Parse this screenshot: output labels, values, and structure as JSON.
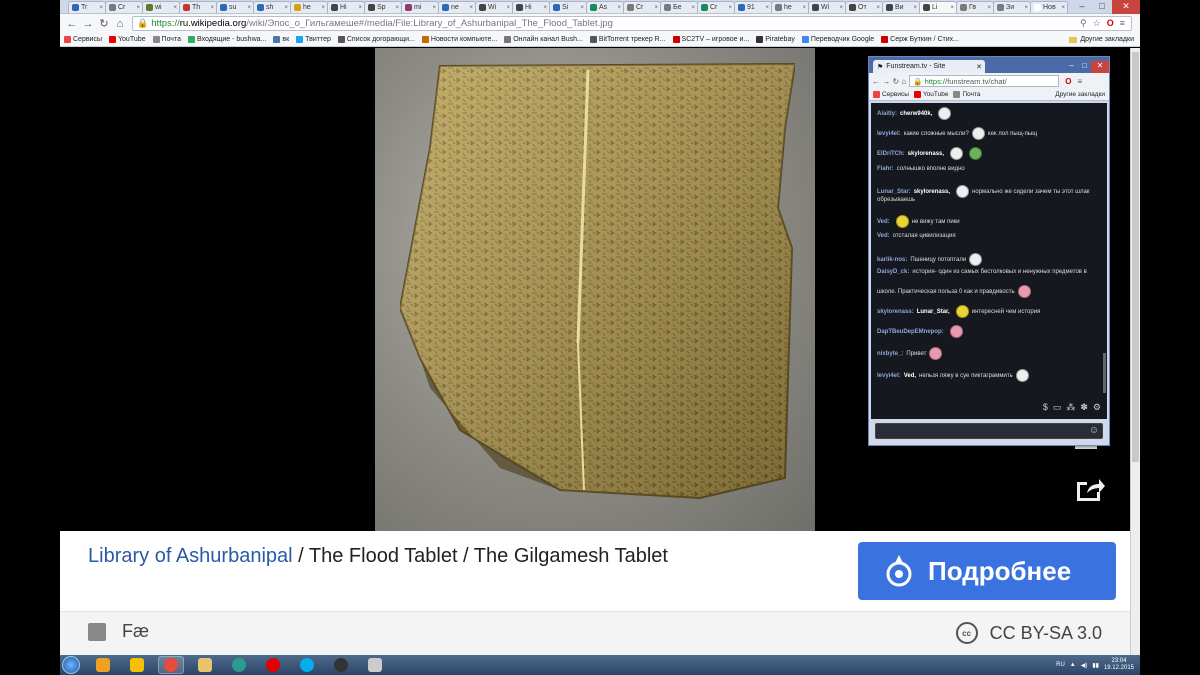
{
  "browser": {
    "tabs": [
      {
        "label": "Tr",
        "color": "#2a6ab6"
      },
      {
        "label": "Cr",
        "color": "#7a7a7a"
      },
      {
        "label": "wi",
        "color": "#5b7a2a"
      },
      {
        "label": "Th",
        "color": "#c0392b"
      },
      {
        "label": "su",
        "color": "#2a6ab6"
      },
      {
        "label": "sh",
        "color": "#2a6ab6"
      },
      {
        "label": "he",
        "color": "#d4a017"
      },
      {
        "label": "Hi",
        "color": "#444444"
      },
      {
        "label": "Sp",
        "color": "#444444"
      },
      {
        "label": "mi",
        "color": "#8e3b6e"
      },
      {
        "label": "ne",
        "color": "#2a6ab6"
      },
      {
        "label": "Wi",
        "color": "#444444"
      },
      {
        "label": "Hi",
        "color": "#444444"
      },
      {
        "label": "Si",
        "color": "#2a6ab6"
      },
      {
        "label": "As",
        "color": "#1a8a5a"
      },
      {
        "label": "Cr",
        "color": "#7a7a7a"
      },
      {
        "label": "Бе",
        "color": "#7a7a7a"
      },
      {
        "label": "Cr",
        "color": "#1a8a5a"
      },
      {
        "label": "91",
        "color": "#2a6ab6"
      },
      {
        "label": "he",
        "color": "#7a7a7a"
      },
      {
        "label": "Wi",
        "color": "#444444"
      },
      {
        "label": "От",
        "color": "#444444"
      },
      {
        "label": "Ви",
        "color": "#444444"
      },
      {
        "label": "Li",
        "color": "#444444",
        "active": true
      },
      {
        "label": "Гв",
        "color": "#7a7a7a"
      },
      {
        "label": "Зи",
        "color": "#7a7a7a"
      },
      {
        "label": "Нов",
        "color": "#ffffff"
      }
    ],
    "url": {
      "protocol": "https://",
      "host": "ru.wikipedia.org",
      "path": "/wiki/Эпос_о_Гильгамеше#/media/File:Library_of_Ashurbanipal_The_Flood_Tablet.jpg"
    },
    "bookmarks": [
      {
        "label": "Сервисы",
        "color": "#e44"
      },
      {
        "label": "YouTube",
        "color": "#e00"
      },
      {
        "label": "Почта",
        "color": "#888"
      },
      {
        "label": "Входящие - bushwa...",
        "color": "#3a6"
      },
      {
        "label": "вк",
        "color": "#4a76a8"
      },
      {
        "label": "Твиттер",
        "color": "#1da1f2"
      },
      {
        "label": "Список догорающи...",
        "color": "#555"
      },
      {
        "label": "Новости компьюте...",
        "color": "#c60"
      },
      {
        "label": "Онлайн канал Bush...",
        "color": "#777"
      },
      {
        "label": "BitTorrent трекер R...",
        "color": "#555"
      },
      {
        "label": "SC2TV – игровое и...",
        "color": "#c00"
      },
      {
        "label": "Piratebay",
        "color": "#333"
      },
      {
        "label": "Переводчик Google",
        "color": "#4285f4"
      },
      {
        "label": "Серж Буткин / Стих...",
        "color": "#c00"
      }
    ],
    "other_bookmarks": "Другие закладки"
  },
  "chat": {
    "tab_title": "Funstream.tv - Site",
    "url_protocol": "https://",
    "url_rest": "funstream.tv/chat/",
    "bookmarks": [
      {
        "label": "Сервисы",
        "color": "#e44"
      },
      {
        "label": "YouTube",
        "color": "#e00"
      },
      {
        "label": "Почта",
        "color": "#888"
      }
    ],
    "other_bookmarks": "Другие закладки",
    "messages": [
      {
        "nick": "Alaitiy:",
        "to": "cherw940k,",
        "text": "",
        "smile": "w"
      },
      {
        "nick": "levyi4el:",
        "to": "",
        "text": "какие сложные мысли?",
        "smile": "w",
        "after": "кек лол пыщ-пыщ"
      },
      {
        "nick": "ElDriTCh:",
        "to": "skylorenass,",
        "text": "",
        "smile": "w",
        "smile2": "g"
      },
      {
        "nick": "Fiahr:",
        "to": "",
        "text": "солнышко вполне видно",
        "smile": ""
      },
      {
        "nick": "Lunar_Star:",
        "to": "skylorenass,",
        "text": "",
        "smile": "w",
        "after": "нормально же сидели зачем ты этот шлак"
      },
      {
        "nick": "",
        "to": "",
        "text": "обрезываешь",
        "smile": ""
      },
      {
        "nick": "Ved:",
        "to": "",
        "text": "",
        "smile": "y",
        "after": "не вижу там пики"
      },
      {
        "nick": "Ved:",
        "to": "",
        "text": "отсталая цивилизация",
        "smile": ""
      },
      {
        "nick": "karlik-nos:",
        "to": "",
        "text": "Пшеницу потоптали",
        "smile": "w"
      },
      {
        "nick": "DaisyD_ck:",
        "to": "",
        "text": "история- один из самых бестолковых и ненужных предметов в",
        "smile": ""
      },
      {
        "nick": "",
        "to": "",
        "text": "школе. Практическая польза 0 как и правдивость",
        "smile": "p"
      },
      {
        "nick": "skylorenass:",
        "to": "Lunar_Star,",
        "text": "",
        "smile": "y",
        "after": "интересней чем история"
      },
      {
        "nick": "DapTBeuDepEМnepop:",
        "to": "",
        "text": "",
        "smile": "p"
      },
      {
        "nick": "nixbyte_:",
        "to": "",
        "text": "Привет",
        "smile": "p"
      },
      {
        "nick": "levyi4el:",
        "to": "Ved,",
        "text": "нельзя ляжу в суе пиктаграммить",
        "smile": "w"
      }
    ]
  },
  "info": {
    "title_link": "Library of Ashurbanipal",
    "title_rest": " / The Flood Tablet / The Gilgamesh Tablet",
    "more_button": "Подробнее",
    "author": "Fæ",
    "cc_badge": "cc",
    "license": "CC BY-SA 3.0"
  },
  "taskbar": {
    "apps": [
      {
        "name": "media-player",
        "color": "#f0a020"
      },
      {
        "name": "browser",
        "color": "#f5c000"
      },
      {
        "name": "chrome",
        "color": "#e84c3d",
        "active": true
      },
      {
        "name": "explorer",
        "color": "#e9c46a"
      },
      {
        "name": "app-globe",
        "color": "#2a9d8f"
      },
      {
        "name": "opera",
        "color": "#e00000"
      },
      {
        "name": "skype",
        "color": "#00aff0"
      },
      {
        "name": "obs",
        "color": "#333333"
      },
      {
        "name": "paint",
        "color": "#cccccc"
      }
    ],
    "lang": "RU",
    "time": "23:04",
    "date": "19.12.2015"
  }
}
